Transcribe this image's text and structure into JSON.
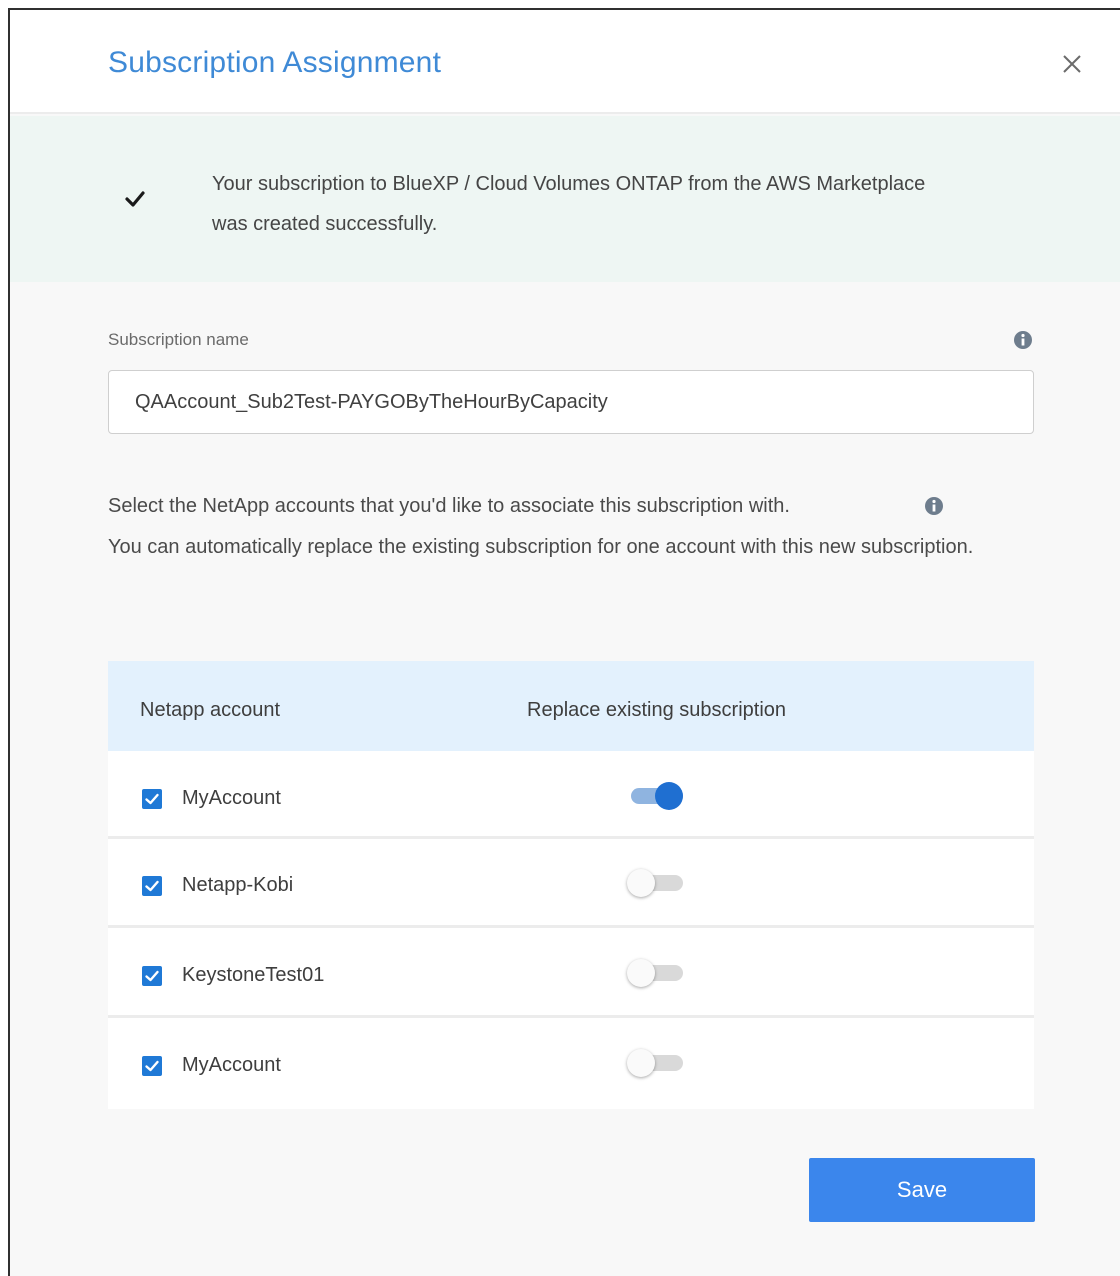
{
  "dialog": {
    "title": "Subscription Assignment",
    "close_icon": "close-icon"
  },
  "banner": {
    "icon": "checkmark-icon",
    "text": "Your subscription to BlueXP / Cloud Volumes ONTAP from the AWS Marketplace was created successfully."
  },
  "subscription": {
    "label": "Subscription name",
    "value": "QAAccount_Sub2Test-PAYGOByTheHourByCapacity",
    "info_icon": "info-icon"
  },
  "description": {
    "line1": "Select the NetApp accounts that you'd like to associate this subscription with.",
    "line2": "You can automatically replace the existing subscription for one account with this new subscription.",
    "info_icon": "info-icon"
  },
  "table": {
    "headers": [
      "Netapp account",
      "Replace existing subscription"
    ],
    "rows": [
      {
        "name": "MyAccount",
        "checked": true,
        "replace": true
      },
      {
        "name": "Netapp-Kobi",
        "checked": true,
        "replace": false
      },
      {
        "name": "KeystoneTest01",
        "checked": true,
        "replace": false
      },
      {
        "name": "MyAccount",
        "checked": true,
        "replace": false
      }
    ]
  },
  "actions": {
    "save_label": "Save"
  },
  "colors": {
    "accent": "#3b86ec",
    "title": "#3f8ad6",
    "banner_bg": "#eef6f3",
    "table_header_bg": "#e3f1fd",
    "toggle_on": "#1f6fd1"
  }
}
